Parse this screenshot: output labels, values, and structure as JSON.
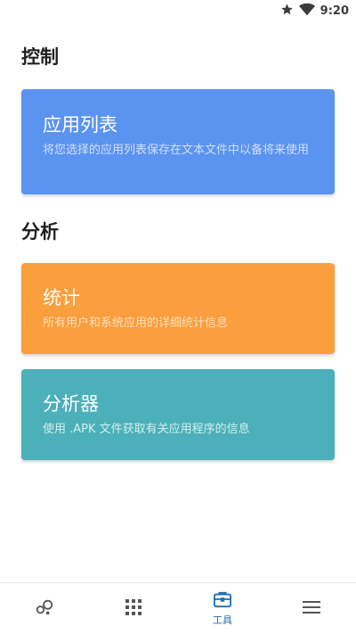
{
  "status_bar": {
    "time": "9:20",
    "icons": [
      "star-icon",
      "wifi-icon"
    ]
  },
  "sections": {
    "control": {
      "title": "控制"
    },
    "analysis": {
      "title": "分析"
    }
  },
  "cards": {
    "app_list": {
      "title": "应用列表",
      "description": "将您选择的应用列表保存在文本文件中以备将来使用",
      "color": "#5b93f0"
    },
    "stats": {
      "title": "统计",
      "description": "所有用户和系统应用的详细统计信息",
      "color": "#fb9e3d"
    },
    "analyzer": {
      "title": "分析器",
      "description": "使用 .APK 文件获取有关应用程序的信息",
      "color": "#4bb0b9"
    }
  },
  "bottom_nav": {
    "items": [
      {
        "icon": "bubbles-icon",
        "label": "",
        "active": false
      },
      {
        "icon": "apps-grid-icon",
        "label": "",
        "active": false
      },
      {
        "icon": "toolbox-icon",
        "label": "工具",
        "active": true
      },
      {
        "icon": "menu-icon",
        "label": "",
        "active": false
      }
    ],
    "active_color": "#1e6fb0",
    "inactive_color": "#555555"
  }
}
